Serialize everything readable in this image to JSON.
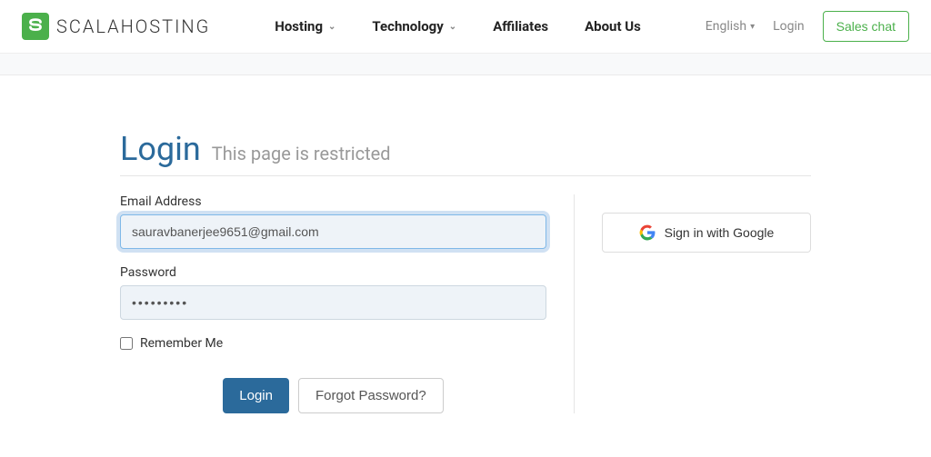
{
  "header": {
    "brand_text": "SCALAHOSTING",
    "nav": [
      {
        "label": "Hosting",
        "has_dropdown": true
      },
      {
        "label": "Technology",
        "has_dropdown": true
      },
      {
        "label": "Affiliates",
        "has_dropdown": false
      },
      {
        "label": "About Us",
        "has_dropdown": false
      }
    ],
    "language": "English",
    "login_link": "Login",
    "sales_chat": "Sales chat"
  },
  "page": {
    "title": "Login",
    "subtitle": "This page is restricted"
  },
  "form": {
    "email_label": "Email Address",
    "email_value": "sauravbanerjee9651@gmail.com",
    "password_label": "Password",
    "password_value": "•••••••••",
    "remember_label": "Remember Me",
    "login_button": "Login",
    "forgot_button": "Forgot Password?"
  },
  "social": {
    "google_label": "Sign in with Google"
  },
  "colors": {
    "brand_green": "#4bb04b",
    "accent_blue": "#2b6a9b",
    "focus_border": "#7fb8e8"
  }
}
